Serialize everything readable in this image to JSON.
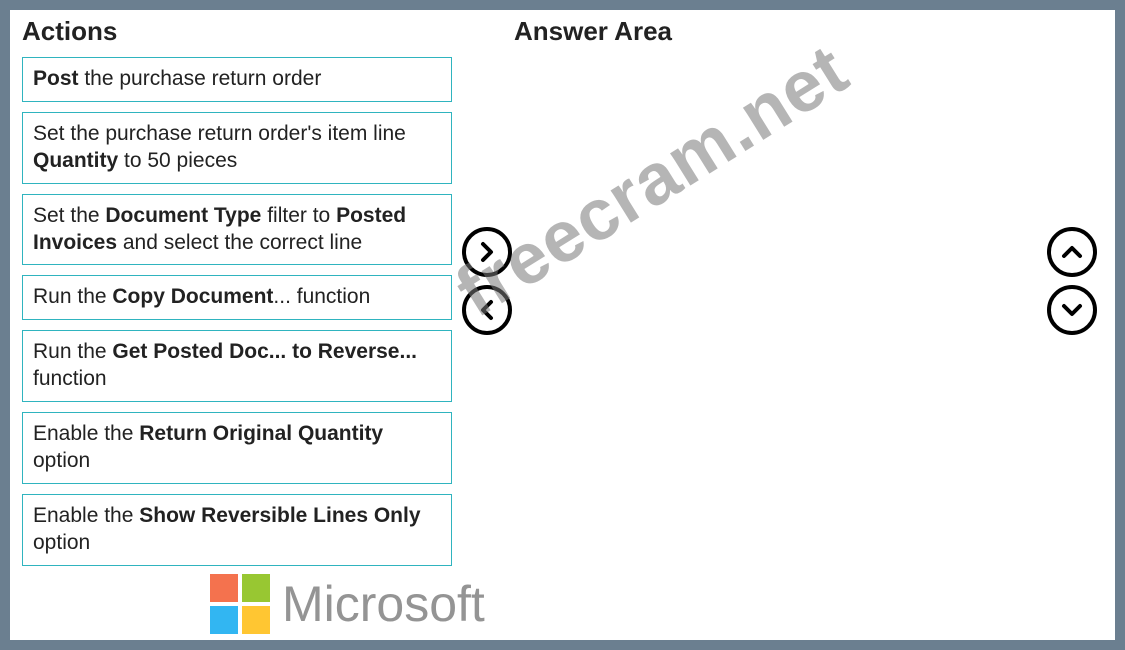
{
  "headings": {
    "actions": "Actions",
    "answer": "Answer Area"
  },
  "actions": [
    {
      "segments": [
        {
          "t": "Post",
          "b": true
        },
        {
          "t": " the purchase return order",
          "b": false
        }
      ]
    },
    {
      "segments": [
        {
          "t": "Set the purchase return order's item line ",
          "b": false
        },
        {
          "t": "Quantity",
          "b": true
        },
        {
          "t": " to 50 pieces",
          "b": false
        }
      ]
    },
    {
      "segments": [
        {
          "t": "Set the ",
          "b": false
        },
        {
          "t": "Document Type",
          "b": true
        },
        {
          "t": " filter to ",
          "b": false
        },
        {
          "t": "Posted Invoices",
          "b": true
        },
        {
          "t": " and select the correct line",
          "b": false
        }
      ]
    },
    {
      "segments": [
        {
          "t": "Run the ",
          "b": false
        },
        {
          "t": "Copy Document",
          "b": true
        },
        {
          "t": "... function",
          "b": false
        }
      ]
    },
    {
      "segments": [
        {
          "t": "Run the ",
          "b": false
        },
        {
          "t": "Get Posted Doc... to Reverse...",
          "b": true
        },
        {
          "t": " function",
          "b": false
        }
      ]
    },
    {
      "segments": [
        {
          "t": "Enable the ",
          "b": false
        },
        {
          "t": "Return Original Quantity",
          "b": true
        },
        {
          "t": " option",
          "b": false
        }
      ]
    },
    {
      "segments": [
        {
          "t": "Enable the ",
          "b": false
        },
        {
          "t": "Show Reversible Lines Only",
          "b": true
        },
        {
          "t": " option",
          "b": false
        }
      ]
    }
  ],
  "watermarks": {
    "diagonal": "freecram.net",
    "microsoft": "Microsoft"
  },
  "buttons": {
    "move_right": ">",
    "move_left": "<",
    "move_up": "^",
    "move_down": "v"
  }
}
